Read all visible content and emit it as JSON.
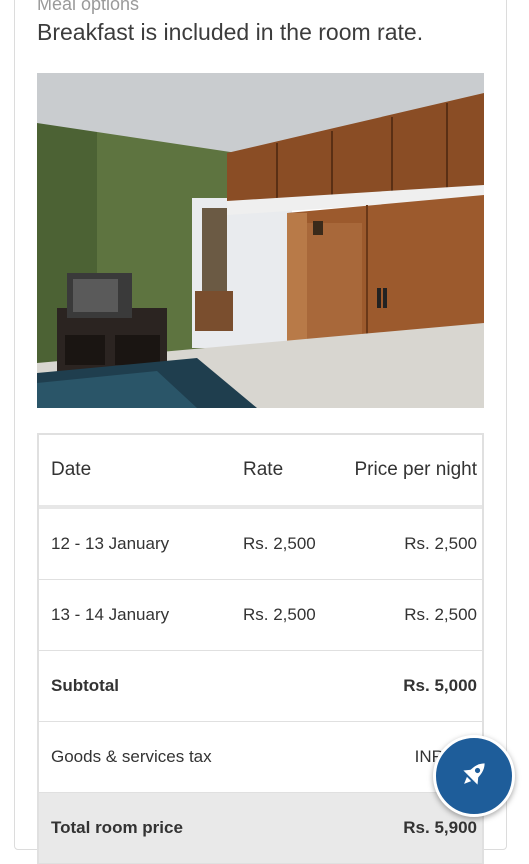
{
  "meal": {
    "heading": "Meal options",
    "text": "Breakfast is included in the room rate."
  },
  "table": {
    "headers": {
      "date": "Date",
      "rate": "Rate",
      "price": "Price per night"
    },
    "rows": [
      {
        "date": "12 - 13 January",
        "rate": "Rs. 2,500",
        "price": "Rs. 2,500"
      },
      {
        "date": "13 - 14 January",
        "rate": "Rs. 2,500",
        "price": "Rs. 2,500"
      }
    ],
    "subtotal": {
      "label": "Subtotal",
      "value": "Rs. 5,000"
    },
    "tax": {
      "label": "Goods & services tax",
      "value": "INR 900"
    },
    "total": {
      "label": "Total room price",
      "value": "Rs. 5,900"
    }
  },
  "fab": {
    "icon": "rocket-icon",
    "color": "#1e5d9a"
  }
}
